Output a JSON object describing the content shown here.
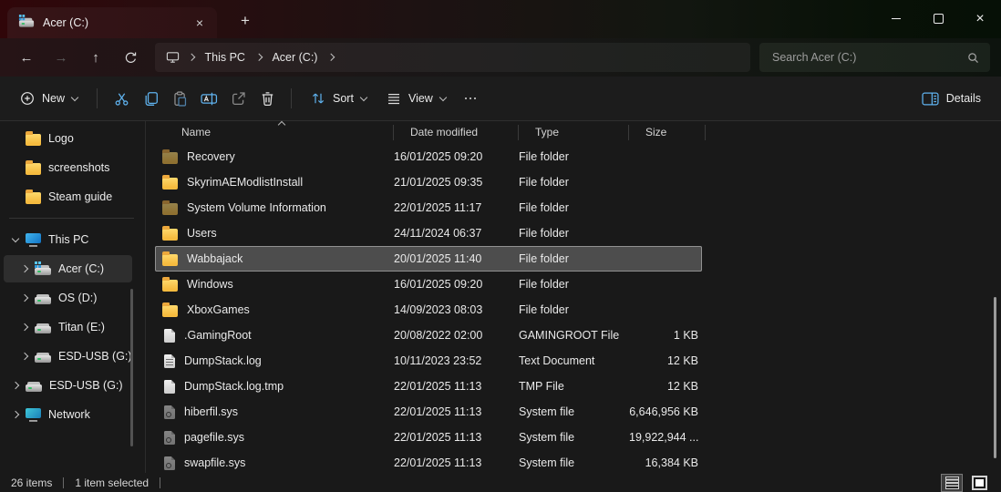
{
  "colors": {
    "accent_blue": "#5fb2ee",
    "folder_yellow": "#f6bb3f",
    "selection_bg": "#4d4d4d",
    "titlebar_left": "#300609",
    "titlebar_right": "#061006",
    "window_bg": "#191919"
  },
  "icons": {
    "back": "←",
    "forward": "→",
    "up": "↑",
    "tab_close": "×",
    "window_close": "×",
    "new_tab": "+"
  },
  "titlebar": {
    "tab_label": "Acer (C:)"
  },
  "nav": {
    "breadcrumb": [
      "This PC",
      "Acer (C:)"
    ],
    "search_placeholder": "Search Acer (C:)"
  },
  "toolbar": {
    "new_label": "New",
    "sort_label": "Sort",
    "view_label": "View",
    "details_label": "Details"
  },
  "sidebar": {
    "pinned": [
      {
        "label": "Logo"
      },
      {
        "label": "screenshots"
      },
      {
        "label": "Steam guide"
      }
    ],
    "tree": [
      {
        "label": "This PC",
        "icon": "monitor",
        "chevron": "down",
        "level": 0,
        "selected": false
      },
      {
        "label": "Acer (C:)",
        "icon": "drive-windows",
        "chevron": "right",
        "level": 1,
        "selected": true
      },
      {
        "label": "OS (D:)",
        "icon": "drive",
        "chevron": "right",
        "level": 1,
        "selected": false
      },
      {
        "label": "Titan (E:)",
        "icon": "drive",
        "chevron": "right",
        "level": 1,
        "selected": false
      },
      {
        "label": "ESD-USB (G:)",
        "icon": "drive",
        "chevron": "right",
        "level": 1,
        "selected": false
      },
      {
        "label": "ESD-USB (G:)",
        "icon": "drive",
        "chevron": "right",
        "level": 0,
        "selected": false
      },
      {
        "label": "Network",
        "icon": "network",
        "chevron": "right",
        "level": 0,
        "selected": false
      }
    ]
  },
  "filelist": {
    "columns": [
      "Name",
      "Date modified",
      "Type",
      "Size"
    ],
    "rows": [
      {
        "name": "Recovery",
        "date": "16/01/2025 09:20",
        "type": "File folder",
        "size": "",
        "icon": "folder-hidden",
        "selected": false
      },
      {
        "name": "SkyrimAEModlistInstall",
        "date": "21/01/2025 09:35",
        "type": "File folder",
        "size": "",
        "icon": "folder",
        "selected": false
      },
      {
        "name": "System Volume Information",
        "date": "22/01/2025 11:17",
        "type": "File folder",
        "size": "",
        "icon": "folder-hidden",
        "selected": false
      },
      {
        "name": "Users",
        "date": "24/11/2024 06:37",
        "type": "File folder",
        "size": "",
        "icon": "folder",
        "selected": false
      },
      {
        "name": "Wabbajack",
        "date": "20/01/2025 11:40",
        "type": "File folder",
        "size": "",
        "icon": "folder",
        "selected": true
      },
      {
        "name": "Windows",
        "date": "16/01/2025 09:20",
        "type": "File folder",
        "size": "",
        "icon": "folder",
        "selected": false
      },
      {
        "name": "XboxGames",
        "date": "14/09/2023 08:03",
        "type": "File folder",
        "size": "",
        "icon": "folder",
        "selected": false
      },
      {
        "name": ".GamingRoot",
        "date": "20/08/2022 02:00",
        "type": "GAMINGROOT File",
        "size": "1 KB",
        "icon": "file-blank",
        "selected": false
      },
      {
        "name": "DumpStack.log",
        "date": "10/11/2023 23:52",
        "type": "Text Document",
        "size": "12 KB",
        "icon": "file-text",
        "selected": false
      },
      {
        "name": "DumpStack.log.tmp",
        "date": "22/01/2025 11:13",
        "type": "TMP File",
        "size": "12 KB",
        "icon": "file-blank",
        "selected": false
      },
      {
        "name": "hiberfil.sys",
        "date": "22/01/2025 11:13",
        "type": "System file",
        "size": "6,646,956 KB",
        "icon": "file-system",
        "selected": false
      },
      {
        "name": "pagefile.sys",
        "date": "22/01/2025 11:13",
        "type": "System file",
        "size": "19,922,944 ...",
        "icon": "file-system",
        "selected": false
      },
      {
        "name": "swapfile.sys",
        "date": "22/01/2025 11:13",
        "type": "System file",
        "size": "16,384 KB",
        "icon": "file-system",
        "selected": false
      }
    ]
  },
  "statusbar": {
    "item_count": "26 items",
    "selection": "1 item selected"
  }
}
